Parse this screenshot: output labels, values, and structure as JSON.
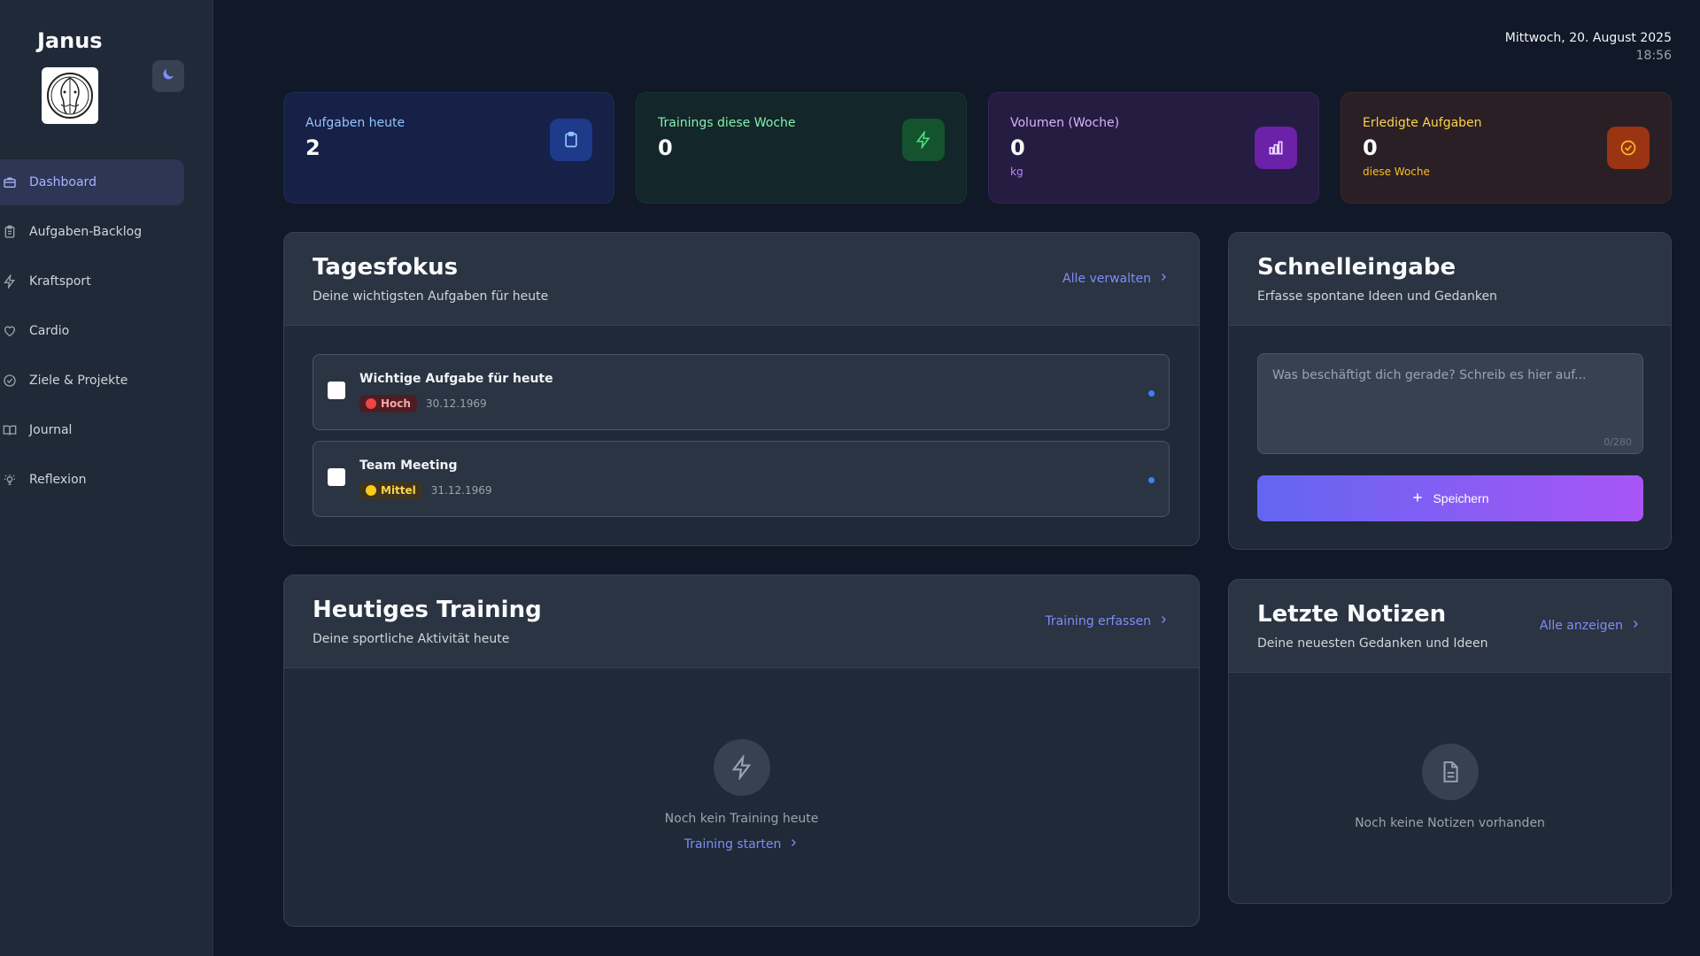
{
  "app": {
    "name": "Janus"
  },
  "sidebar": {
    "items": [
      {
        "label": "Dashboard",
        "icon": "briefcase-icon"
      },
      {
        "label": "Aufgaben-Backlog",
        "icon": "clipboard-icon"
      },
      {
        "label": "Kraftsport",
        "icon": "lightning-icon"
      },
      {
        "label": "Cardio",
        "icon": "heart-icon"
      },
      {
        "label": "Ziele & Projekte",
        "icon": "check-circle-icon"
      },
      {
        "label": "Journal",
        "icon": "book-icon"
      },
      {
        "label": "Reflexion",
        "icon": "lightbulb-icon"
      }
    ]
  },
  "header": {
    "date": "Mittwoch, 20. August 2025",
    "time": "18:56"
  },
  "stats": [
    {
      "label": "Aufgaben heute",
      "value": "2",
      "sub": "",
      "icon": "clipboard-icon"
    },
    {
      "label": "Trainings diese Woche",
      "value": "0",
      "sub": "",
      "icon": "lightning-icon"
    },
    {
      "label": "Volumen (Woche)",
      "value": "0",
      "sub": "kg",
      "icon": "bar-chart-icon"
    },
    {
      "label": "Erledigte Aufgaben",
      "value": "0",
      "sub": "diese Woche",
      "icon": "check-circle-icon"
    }
  ],
  "focus": {
    "title": "Tagesfokus",
    "subtitle": "Deine wichtigsten Aufgaben für heute",
    "link": "Alle verwalten",
    "tasks": [
      {
        "title": "Wichtige Aufgabe für heute",
        "priority": "Hoch",
        "date": "30.12.1969"
      },
      {
        "title": "Team Meeting",
        "priority": "Mittel",
        "date": "31.12.1969"
      }
    ]
  },
  "quick": {
    "title": "Schnelleingabe",
    "subtitle": "Erfasse spontane Ideen und Gedanken",
    "placeholder": "Was beschäftigt dich gerade? Schreib es hier auf...",
    "counter": "0/280",
    "button": "Speichern"
  },
  "training": {
    "title": "Heutiges Training",
    "subtitle": "Deine sportliche Aktivität heute",
    "link": "Training erfassen",
    "empty": "Noch kein Training heute",
    "empty_link": "Training starten"
  },
  "notes": {
    "title": "Letzte Notizen",
    "subtitle": "Deine neuesten Gedanken und Ideen",
    "link": "Alle anzeigen",
    "empty": "Noch keine Notizen vorhanden"
  },
  "colors": {
    "accent": "#818cf8",
    "bg": "#111827",
    "panel": "#1f2937"
  }
}
